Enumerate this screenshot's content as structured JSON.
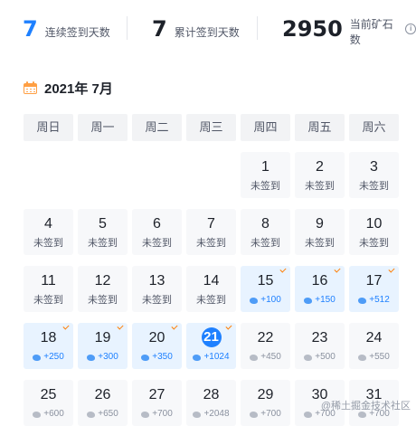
{
  "stats": {
    "streak": {
      "value": "7",
      "label": "连续签到天数"
    },
    "total": {
      "value": "7",
      "label": "累计签到天数"
    },
    "ore": {
      "value": "2950",
      "label": "当前矿石数"
    }
  },
  "calendar": {
    "title": "2021年 7月",
    "weekdays": [
      "周日",
      "周一",
      "周二",
      "周三",
      "周四",
      "周五",
      "周六"
    ],
    "today": "21",
    "days": [
      {
        "day": "1",
        "status": "未签到"
      },
      {
        "day": "2",
        "status": "未签到"
      },
      {
        "day": "3",
        "status": "未签到"
      },
      {
        "day": "4",
        "status": "未签到"
      },
      {
        "day": "5",
        "status": "未签到"
      },
      {
        "day": "6",
        "status": "未签到"
      },
      {
        "day": "7",
        "status": "未签到"
      },
      {
        "day": "8",
        "status": "未签到"
      },
      {
        "day": "9",
        "status": "未签到"
      },
      {
        "day": "10",
        "status": "未签到"
      },
      {
        "day": "11",
        "status": "未签到"
      },
      {
        "day": "12",
        "status": "未签到"
      },
      {
        "day": "13",
        "status": "未签到"
      },
      {
        "day": "14",
        "status": "未签到"
      },
      {
        "day": "15",
        "reward": "+100",
        "checked": true
      },
      {
        "day": "16",
        "reward": "+150",
        "checked": true
      },
      {
        "day": "17",
        "reward": "+512",
        "checked": true
      },
      {
        "day": "18",
        "reward": "+250",
        "checked": true
      },
      {
        "day": "19",
        "reward": "+300",
        "checked": true
      },
      {
        "day": "20",
        "reward": "+350",
        "checked": true
      },
      {
        "day": "21",
        "reward": "+1024",
        "checked": true
      },
      {
        "day": "22",
        "reward": "+450",
        "checked": false
      },
      {
        "day": "23",
        "reward": "+500",
        "checked": false
      },
      {
        "day": "24",
        "reward": "+550",
        "checked": false
      },
      {
        "day": "25",
        "reward": "+600",
        "checked": false
      },
      {
        "day": "26",
        "reward": "+650",
        "checked": false
      },
      {
        "day": "27",
        "reward": "+700",
        "checked": false
      },
      {
        "day": "28",
        "reward": "+2048",
        "checked": false
      },
      {
        "day": "29",
        "reward": "+700",
        "checked": false
      },
      {
        "day": "30",
        "reward": "+700",
        "checked": false
      },
      {
        "day": "31",
        "reward": "+700",
        "checked": false
      }
    ]
  },
  "watermark": "@稀土掘金技术社区",
  "colors": {
    "accent": "#1e80ff",
    "checkmark": "#ff7d00",
    "calendar_icon": "#ff9f43"
  }
}
